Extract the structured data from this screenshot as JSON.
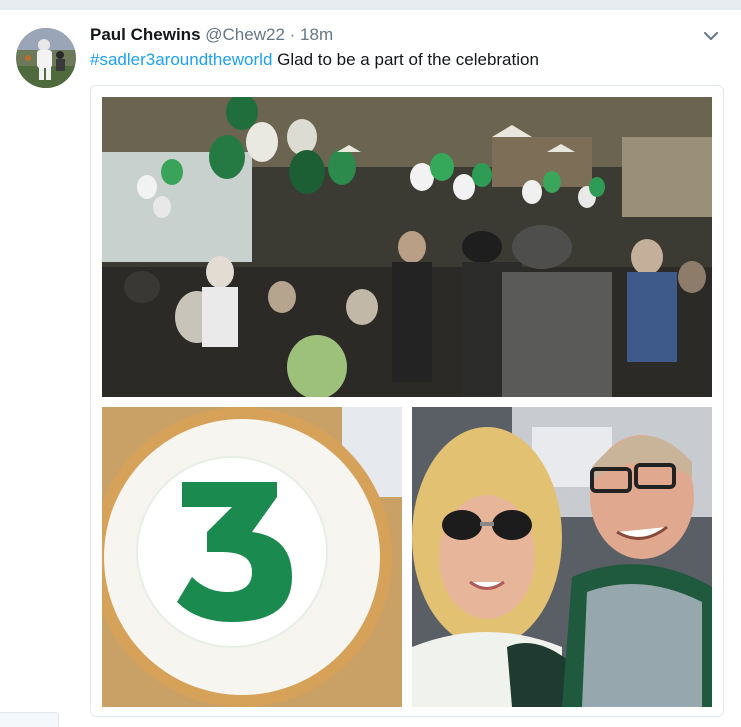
{
  "tweet": {
    "author_name": "Paul Chewins",
    "handle": "@Chew22",
    "separator": "·",
    "timestamp": "18m",
    "hashtag": "#sadler3aroundtheworld",
    "text": "Glad to be a part of the celebration",
    "avatar_icon": "football-player-avatar",
    "menu_icon": "chevron-down-icon"
  },
  "media": {
    "photos": [
      {
        "name": "restaurant-celebration-photo"
      },
      {
        "name": "number-3-cookie-photo",
        "cookie_number": "3"
      },
      {
        "name": "couple-selfie-photo"
      }
    ]
  },
  "colors": {
    "hashtag": "#1da1f2",
    "name": "#14171a",
    "meta": "#657786",
    "spartan_green": "#18453b"
  }
}
